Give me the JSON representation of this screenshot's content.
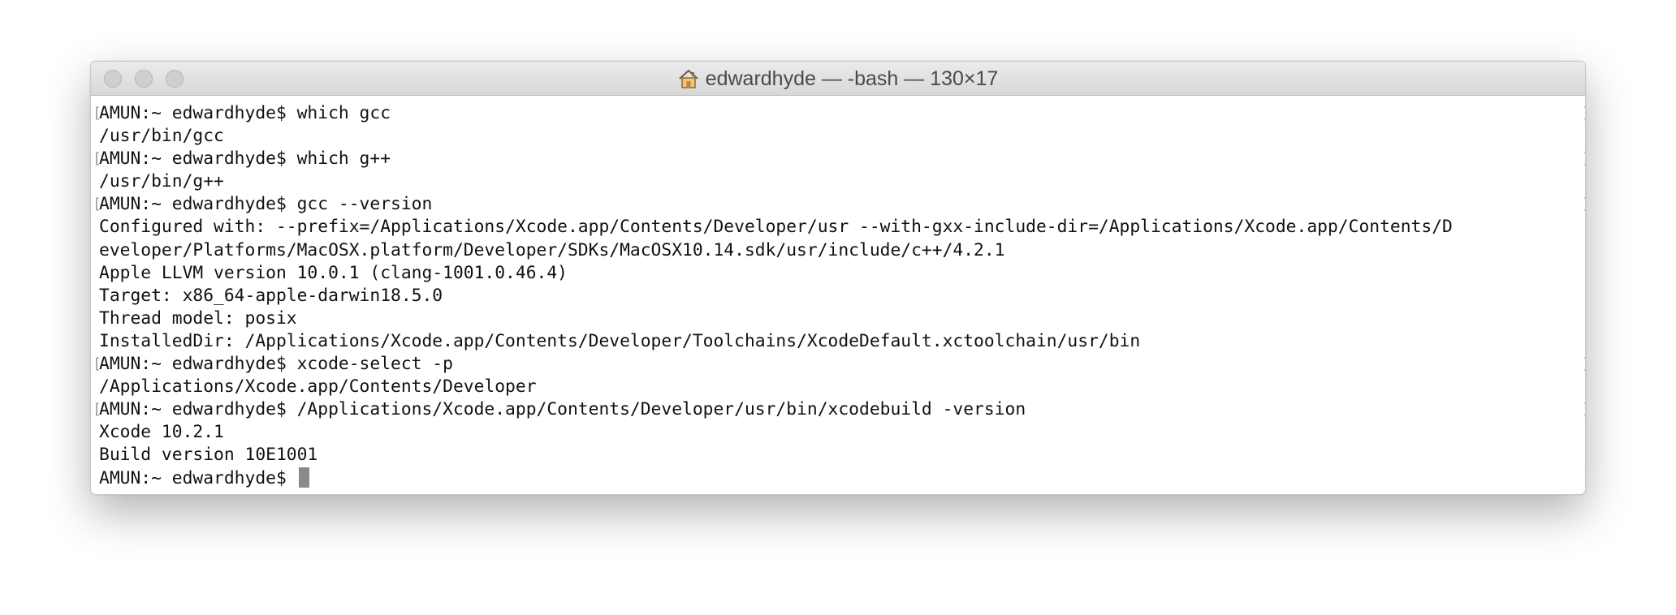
{
  "window": {
    "title": "edwardhyde — -bash — 130×17"
  },
  "terminal": {
    "lines": [
      {
        "text": "AMUN:~ edwardhyde$ which gcc",
        "prompt": true
      },
      {
        "text": "/usr/bin/gcc",
        "prompt": false
      },
      {
        "text": "AMUN:~ edwardhyde$ which g++",
        "prompt": true
      },
      {
        "text": "/usr/bin/g++",
        "prompt": false
      },
      {
        "text": "AMUN:~ edwardhyde$ gcc --version",
        "prompt": true
      },
      {
        "text": "Configured with: --prefix=/Applications/Xcode.app/Contents/Developer/usr --with-gxx-include-dir=/Applications/Xcode.app/Contents/D",
        "prompt": false
      },
      {
        "text": "eveloper/Platforms/MacOSX.platform/Developer/SDKs/MacOSX10.14.sdk/usr/include/c++/4.2.1",
        "prompt": false
      },
      {
        "text": "Apple LLVM version 10.0.1 (clang-1001.0.46.4)",
        "prompt": false
      },
      {
        "text": "Target: x86_64-apple-darwin18.5.0",
        "prompt": false
      },
      {
        "text": "Thread model: posix",
        "prompt": false
      },
      {
        "text": "InstalledDir: /Applications/Xcode.app/Contents/Developer/Toolchains/XcodeDefault.xctoolchain/usr/bin",
        "prompt": false
      },
      {
        "text": "AMUN:~ edwardhyde$ xcode-select -p",
        "prompt": true
      },
      {
        "text": "/Applications/Xcode.app/Contents/Developer",
        "prompt": false
      },
      {
        "text": "AMUN:~ edwardhyde$ /Applications/Xcode.app/Contents/Developer/usr/bin/xcodebuild -version",
        "prompt": true
      },
      {
        "text": "Xcode 10.2.1",
        "prompt": false
      },
      {
        "text": "Build version 10E1001",
        "prompt": false
      }
    ],
    "current_prompt": "AMUN:~ edwardhyde$ "
  },
  "colors": {
    "cursor": "#8a8a8a",
    "text": "#111111",
    "titlebar": "#e0e0e0"
  },
  "icons": {
    "title_icon": "home-icon"
  }
}
